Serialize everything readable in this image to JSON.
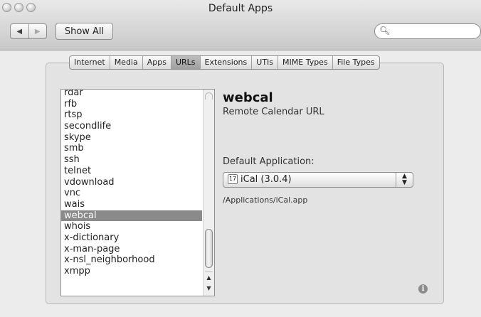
{
  "window": {
    "title": "Default Apps"
  },
  "toolbar": {
    "back_glyph": "◀",
    "forward_glyph": "▶",
    "show_all_label": "Show All",
    "search": {
      "value": "",
      "placeholder": "",
      "icon": "search-icon"
    }
  },
  "tabs": [
    {
      "label": "Internet",
      "selected": false
    },
    {
      "label": "Media",
      "selected": false
    },
    {
      "label": "Apps",
      "selected": false
    },
    {
      "label": "URLs",
      "selected": true
    },
    {
      "label": "Extensions",
      "selected": false
    },
    {
      "label": "UTIs",
      "selected": false
    },
    {
      "label": "MIME Types",
      "selected": false
    },
    {
      "label": "File Types",
      "selected": false
    }
  ],
  "url_list": {
    "items": [
      "rdar",
      "rfb",
      "rtsp",
      "secondlife",
      "skype",
      "smb",
      "ssh",
      "telnet",
      "vdownload",
      "vnc",
      "wais",
      "webcal",
      "whois",
      "x-dictionary",
      "x-man-page",
      "x-nsl_neighborhood",
      "xmpp"
    ],
    "selected": "webcal"
  },
  "detail": {
    "scheme": "webcal",
    "description": "Remote Calendar URL",
    "default_app_label": "Default Application:",
    "default_app_value": "iCal (3.0.4)",
    "app_path": "/Applications/iCal.app",
    "info_glyph": "i"
  },
  "colors": {
    "selection": "#8a8a8a",
    "window": "#ececec"
  }
}
